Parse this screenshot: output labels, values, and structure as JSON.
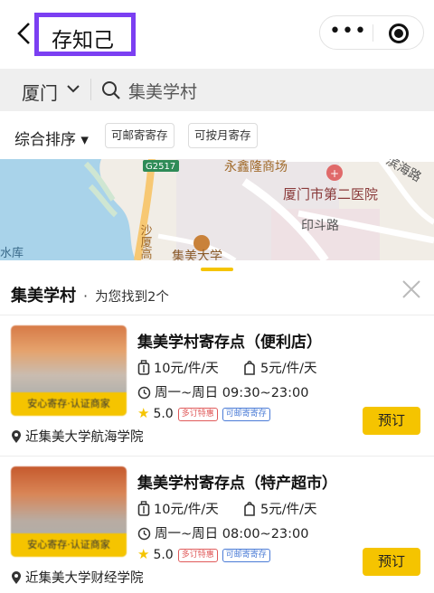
{
  "header": {
    "title": "存知己",
    "more_icon_glyph": "•••",
    "accent_color": "#7b3ff2"
  },
  "search": {
    "city": "厦门",
    "query": "集美学村"
  },
  "filters": {
    "sort_label": "综合排序 ▾",
    "chips": [
      "可邮寄寄存",
      "可按月寄存"
    ]
  },
  "map": {
    "labels": {
      "road_badge": "G2517",
      "mall": "永鑫隆商场",
      "hospital": "厦门市第二医院",
      "road_yindou": "印斗路",
      "road_haijing": "滨海路",
      "road_shaxia": "沙厦高",
      "campus": "集美大学",
      "reservoir": "水库"
    }
  },
  "results": {
    "location": "集美学村",
    "found_text": "为您找到2个",
    "brand_color": "#f5c400",
    "items": [
      {
        "name": "集美学村寄存点（便利店）",
        "badge": "安心寄存·认证商家",
        "price_bag": "10元/件/天",
        "price_backpack": "5元/件/天",
        "hours": "周一~周日 09:30~23:00",
        "rating": "5.0",
        "tags": [
          "多订特惠",
          "可邮寄寄存"
        ],
        "address": "近集美大学航海学院",
        "book_label": "预订"
      },
      {
        "name": "集美学村寄存点（特产超市）",
        "badge": "安心寄存·认证商家",
        "price_bag": "10元/件/天",
        "price_backpack": "5元/件/天",
        "hours": "周一~周日 08:00~23:00",
        "rating": "5.0",
        "tags": [
          "多订特惠",
          "可邮寄寄存"
        ],
        "address": "近集美大学财经学院",
        "book_label": "预订"
      }
    ]
  }
}
